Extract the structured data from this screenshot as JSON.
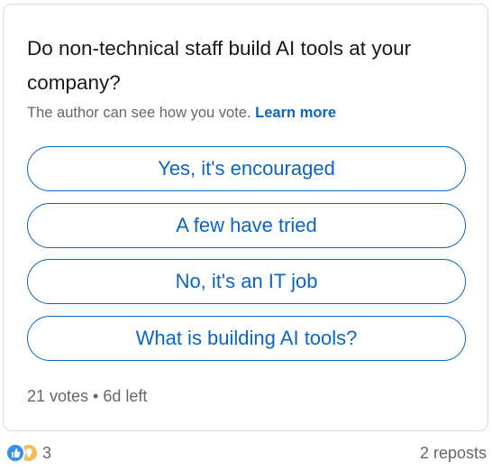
{
  "poll": {
    "question": "Do non-technical staff build AI tools at your company?",
    "privacy_text": "The author can see how you vote.",
    "learn_more": "Learn more",
    "options": [
      "Yes, it's encouraged",
      "A few have tried",
      "No, it's an IT job",
      "What is building AI tools?"
    ],
    "meta": "21 votes • 6d left"
  },
  "footer": {
    "reaction_icons": [
      "like-icon",
      "insightful-icon"
    ],
    "reaction_count": "3",
    "reposts": "2 reposts"
  },
  "colors": {
    "accent": "#0a66c2",
    "text": "#191919",
    "muted": "#666666",
    "like": "#378fe9",
    "insightful": "#f5bb5c"
  }
}
